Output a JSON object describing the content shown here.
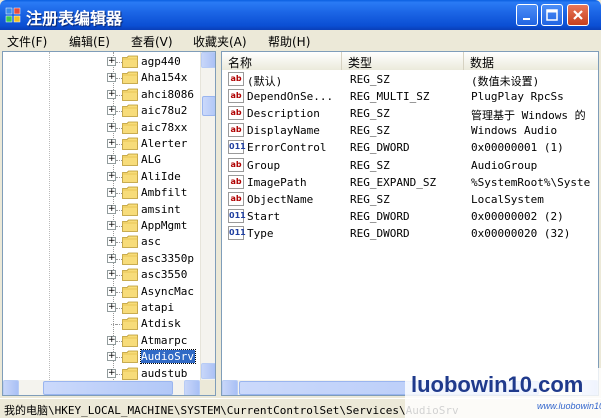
{
  "window": {
    "title": "注册表编辑器",
    "accent": "#0B4FD4",
    "close_color": "#C7401D"
  },
  "menu": [
    {
      "label": "文件(F)"
    },
    {
      "label": "编辑(E)"
    },
    {
      "label": "查看(V)"
    },
    {
      "label": "收藏夹(A)"
    },
    {
      "label": "帮助(H)"
    }
  ],
  "tree": {
    "items": [
      {
        "label": "agp440",
        "expander": "+"
      },
      {
        "label": "Aha154x",
        "expander": "+"
      },
      {
        "label": "ahci8086",
        "expander": "+"
      },
      {
        "label": "aic78u2",
        "expander": "+"
      },
      {
        "label": "aic78xx",
        "expander": "+"
      },
      {
        "label": "Alerter",
        "expander": "+"
      },
      {
        "label": "ALG",
        "expander": "+"
      },
      {
        "label": "AliIde",
        "expander": "+"
      },
      {
        "label": "Ambfilt",
        "expander": "+"
      },
      {
        "label": "amsint",
        "expander": "+"
      },
      {
        "label": "AppMgmt",
        "expander": "+"
      },
      {
        "label": "asc",
        "expander": "+"
      },
      {
        "label": "asc3350p",
        "expander": "+"
      },
      {
        "label": "asc3550",
        "expander": "+"
      },
      {
        "label": "AsyncMac",
        "expander": "+"
      },
      {
        "label": "atapi",
        "expander": "+"
      },
      {
        "label": "Atdisk",
        "expander": ""
      },
      {
        "label": "Atmarpc",
        "expander": "+"
      },
      {
        "label": "AudioSrv",
        "expander": "+",
        "selected": true
      },
      {
        "label": "audstub",
        "expander": "+"
      }
    ]
  },
  "list": {
    "columns": [
      "名称",
      "类型",
      "数据"
    ],
    "rows": [
      {
        "icon": "ab",
        "name": "(默认)",
        "type": "REG_SZ",
        "data": "(数值未设置)"
      },
      {
        "icon": "ab",
        "name": "DependOnSe...",
        "type": "REG_MULTI_SZ",
        "data": "PlugPlay RpcSs"
      },
      {
        "icon": "ab",
        "name": "Description",
        "type": "REG_SZ",
        "data": "管理基于 Windows 的"
      },
      {
        "icon": "ab",
        "name": "DisplayName",
        "type": "REG_SZ",
        "data": "Windows Audio"
      },
      {
        "icon": "bin",
        "name": "ErrorControl",
        "type": "REG_DWORD",
        "data": "0x00000001 (1)"
      },
      {
        "icon": "ab",
        "name": "Group",
        "type": "REG_SZ",
        "data": "AudioGroup"
      },
      {
        "icon": "ab",
        "name": "ImagePath",
        "type": "REG_EXPAND_SZ",
        "data": "%SystemRoot%\\Syste"
      },
      {
        "icon": "ab",
        "name": "ObjectName",
        "type": "REG_SZ",
        "data": "LocalSystem"
      },
      {
        "icon": "bin",
        "name": "Start",
        "type": "REG_DWORD",
        "data": "0x00000002 (2)"
      },
      {
        "icon": "bin",
        "name": "Type",
        "type": "REG_DWORD",
        "data": "0x00000020 (32)"
      }
    ]
  },
  "status": {
    "path": "我的电脑\\HKEY_LOCAL_MACHINE\\SYSTEM\\CurrentControlSet\\Services\\AudioSrv"
  },
  "watermark": {
    "text": "luobowin10.com",
    "sub": "www.luobowin10.com"
  }
}
